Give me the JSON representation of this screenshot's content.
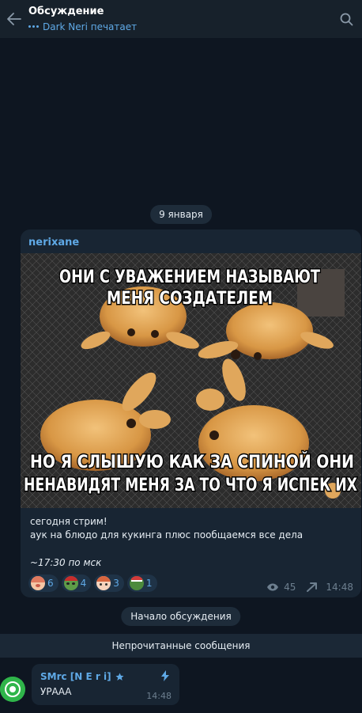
{
  "header": {
    "title": "Обсуждение",
    "status": "Dark Neri печатает",
    "back_icon": "arrow-left-icon",
    "search_icon": "search-icon"
  },
  "date_separator": "9 января",
  "post": {
    "author": "nerixane",
    "image": {
      "caption_top_line1": "ОНИ С УВАЖЕНИЕМ НАЗЫВАЮТ",
      "caption_top_line2": "МЕНЯ СОЗДАТЕЛЕМ",
      "caption_bottom_line1": "НО Я СЛЫШУЮ КАК ЗА СПИНОЙ ОНИ",
      "caption_bottom_line2": "НЕНАВИДЯТ МЕНЯ ЗА ТО ЧТО Я ИСПЕК ИХ"
    },
    "text_line1": "сегодня стрим!",
    "text_line2": "аук на блюдо для кукинга плюс пообщаемся все дела",
    "time_note": "~17:30 по мск",
    "reactions": [
      {
        "emoji": "girl-emoji",
        "count": "6"
      },
      {
        "emoji": "pepe-santa-emoji",
        "count": "4"
      },
      {
        "emoji": "anime-girl-emoji",
        "count": "3"
      },
      {
        "emoji": "pepe-santa-hat-emoji",
        "count": "1"
      }
    ],
    "views": "45",
    "time": "14:48"
  },
  "discussion_start": "Начало обсуждения",
  "unread_label": "Непрочитанные сообщения",
  "comment": {
    "author": "SMrc [N E r i]",
    "text": "УРАAA",
    "time": "14:48"
  },
  "colors": {
    "accent": "#5fa9e6",
    "header_bg": "#17212b",
    "chat_bg": "#0e1621",
    "bubble_bg": "#182533"
  }
}
